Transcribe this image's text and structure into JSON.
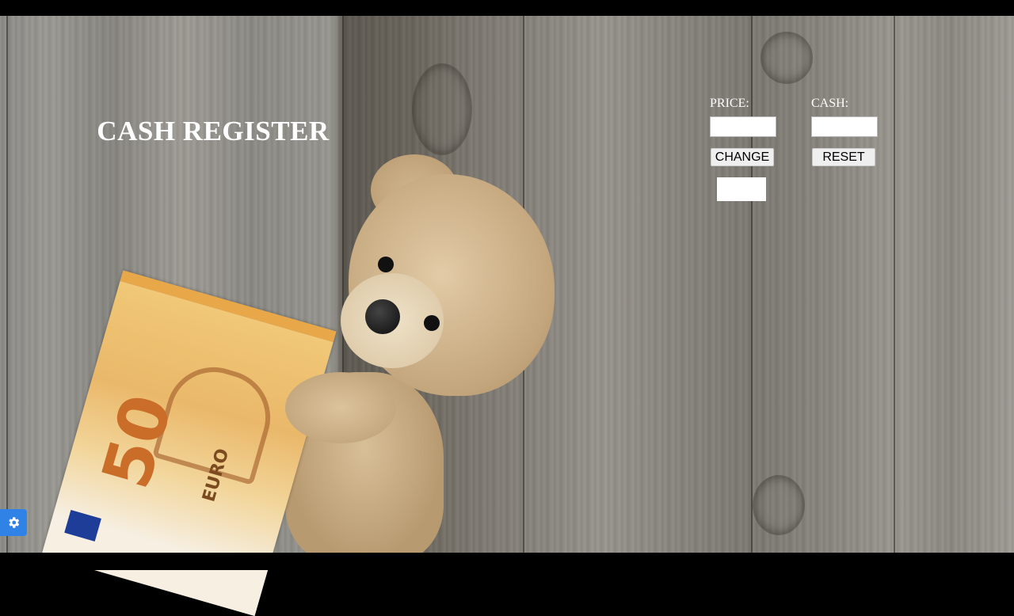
{
  "app": {
    "title": "CASH REGISTER"
  },
  "form": {
    "price_label": "PRICE:",
    "price_value": "",
    "cash_label": "CASH:",
    "cash_value": "",
    "change_button": "CHANGE",
    "reset_button": "RESET",
    "result_value": ""
  },
  "banknote": {
    "denomination": "50",
    "currency": "EURO"
  },
  "icons": {
    "settings": "gear-icon"
  },
  "colors": {
    "title_text": "#ffffff",
    "settings_button": "#2f82e6"
  }
}
